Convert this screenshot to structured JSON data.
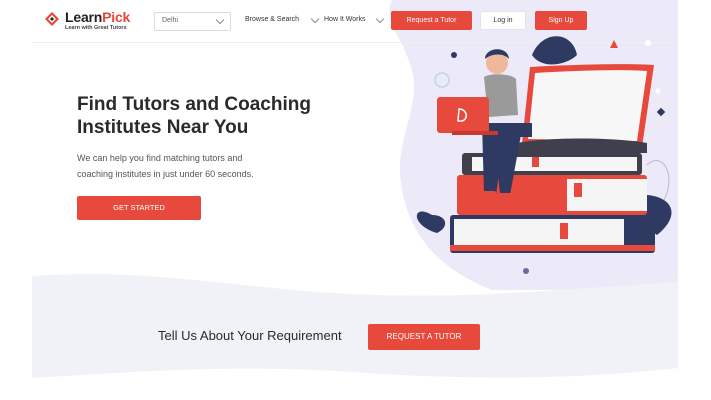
{
  "header": {
    "logo": {
      "brand_first": "Learn",
      "brand_second": "Pick",
      "tagline": "Learn with Great Tutors"
    },
    "location": {
      "value": "Delhi"
    },
    "nav": [
      {
        "label": "Browse & Search"
      },
      {
        "label": "How It Works"
      }
    ],
    "request_tutor_label": "Request a Tutor",
    "login_label": "Log in",
    "signup_label": "Sign Up"
  },
  "hero": {
    "title_line1": "Find Tutors and Coaching",
    "title_line2": "Institutes Near You",
    "subtitle_line1": "We can help you find matching tutors and",
    "subtitle_line2": "coaching institutes in just under 60 seconds.",
    "cta_label": "GET STARTED"
  },
  "requirement": {
    "text": "Tell Us About Your Requirement",
    "cta_label": "REQUEST A TUTOR"
  },
  "colors": {
    "accent": "#e8493d",
    "blob": "#eceaf8",
    "navy": "#2f3a62"
  },
  "icons": [
    "diamond-logo-icon",
    "chevron-down-icon",
    "hero-illustration"
  ]
}
